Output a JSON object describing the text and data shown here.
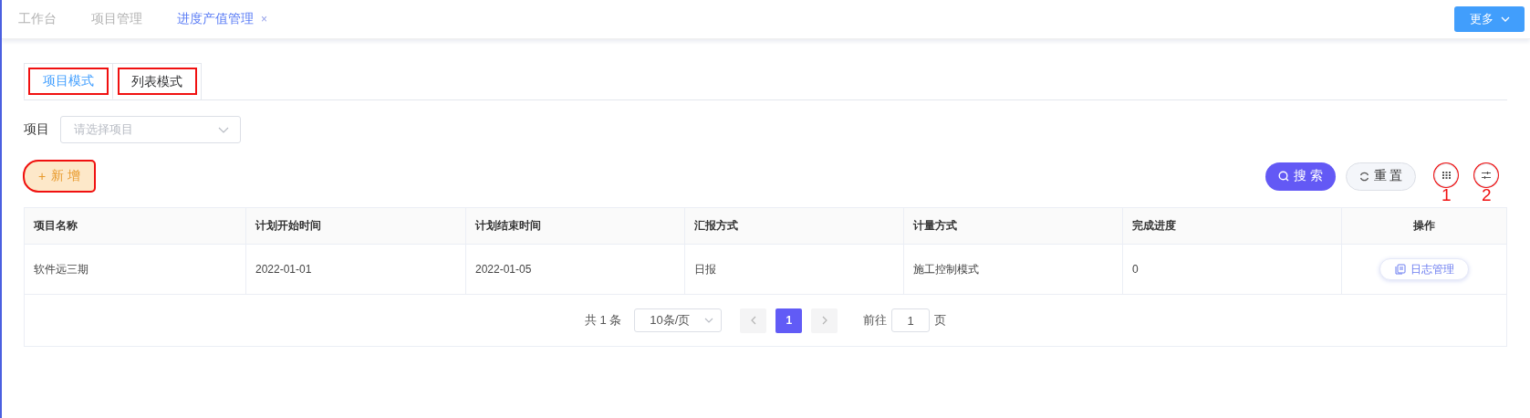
{
  "nav_tabs": [
    {
      "label": "工作台",
      "selected": false
    },
    {
      "label": "项目管理",
      "selected": false
    },
    {
      "label": "进度产值管理",
      "selected": true,
      "close_icon": "×"
    }
  ],
  "more_button": {
    "label": "更多"
  },
  "mode_tabs": [
    {
      "label": "项目模式",
      "selected": true,
      "highlighted": true
    },
    {
      "label": "列表模式",
      "selected": false,
      "highlighted": true
    }
  ],
  "filter": {
    "label": "项目",
    "placeholder": "请选择项目"
  },
  "add_button": {
    "icon": "+",
    "label": "新 增",
    "highlighted": true
  },
  "search_button": {
    "label": "搜 索"
  },
  "reset_button": {
    "label": "重 置"
  },
  "tool_buttons": [
    {
      "kind": "grid",
      "highlighted": true,
      "annotation": "1"
    },
    {
      "kind": "filter",
      "highlighted": true,
      "annotation": "2"
    }
  ],
  "table": {
    "columns": [
      {
        "label": "项目名称"
      },
      {
        "label": "计划开始时间"
      },
      {
        "label": "计划结束时间"
      },
      {
        "label": "汇报方式"
      },
      {
        "label": "计量方式"
      },
      {
        "label": "完成进度"
      },
      {
        "label": "操作"
      }
    ],
    "rows": [
      {
        "cells": [
          "软件远三期",
          "2022-01-01",
          "2022-01-05",
          "日报",
          "施工控制模式",
          "0"
        ],
        "action": "日志管理"
      }
    ]
  },
  "pagination": {
    "total": "共 1 条",
    "page_size": "10条/页",
    "pages": [
      {
        "label": "1",
        "selected": true
      }
    ],
    "goto_label": "前往",
    "goto_value": "1",
    "page_suffix": "页"
  }
}
